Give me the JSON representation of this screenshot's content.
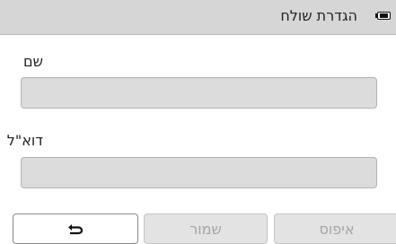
{
  "header": {
    "title": "הגדרת שולח",
    "battery_icon": "battery-full-icon"
  },
  "form": {
    "name_label": "שם",
    "name_value": "",
    "email_label": "דוא\"ל",
    "email_value": ""
  },
  "buttons": {
    "back_icon": "back-arrow-icon",
    "save_label": "שמור",
    "reset_label": "איפוס"
  },
  "colors": {
    "titlebar": "#d6d6d6",
    "input_background": "#dcdcdc",
    "disabled_text": "#a5a5a5"
  }
}
